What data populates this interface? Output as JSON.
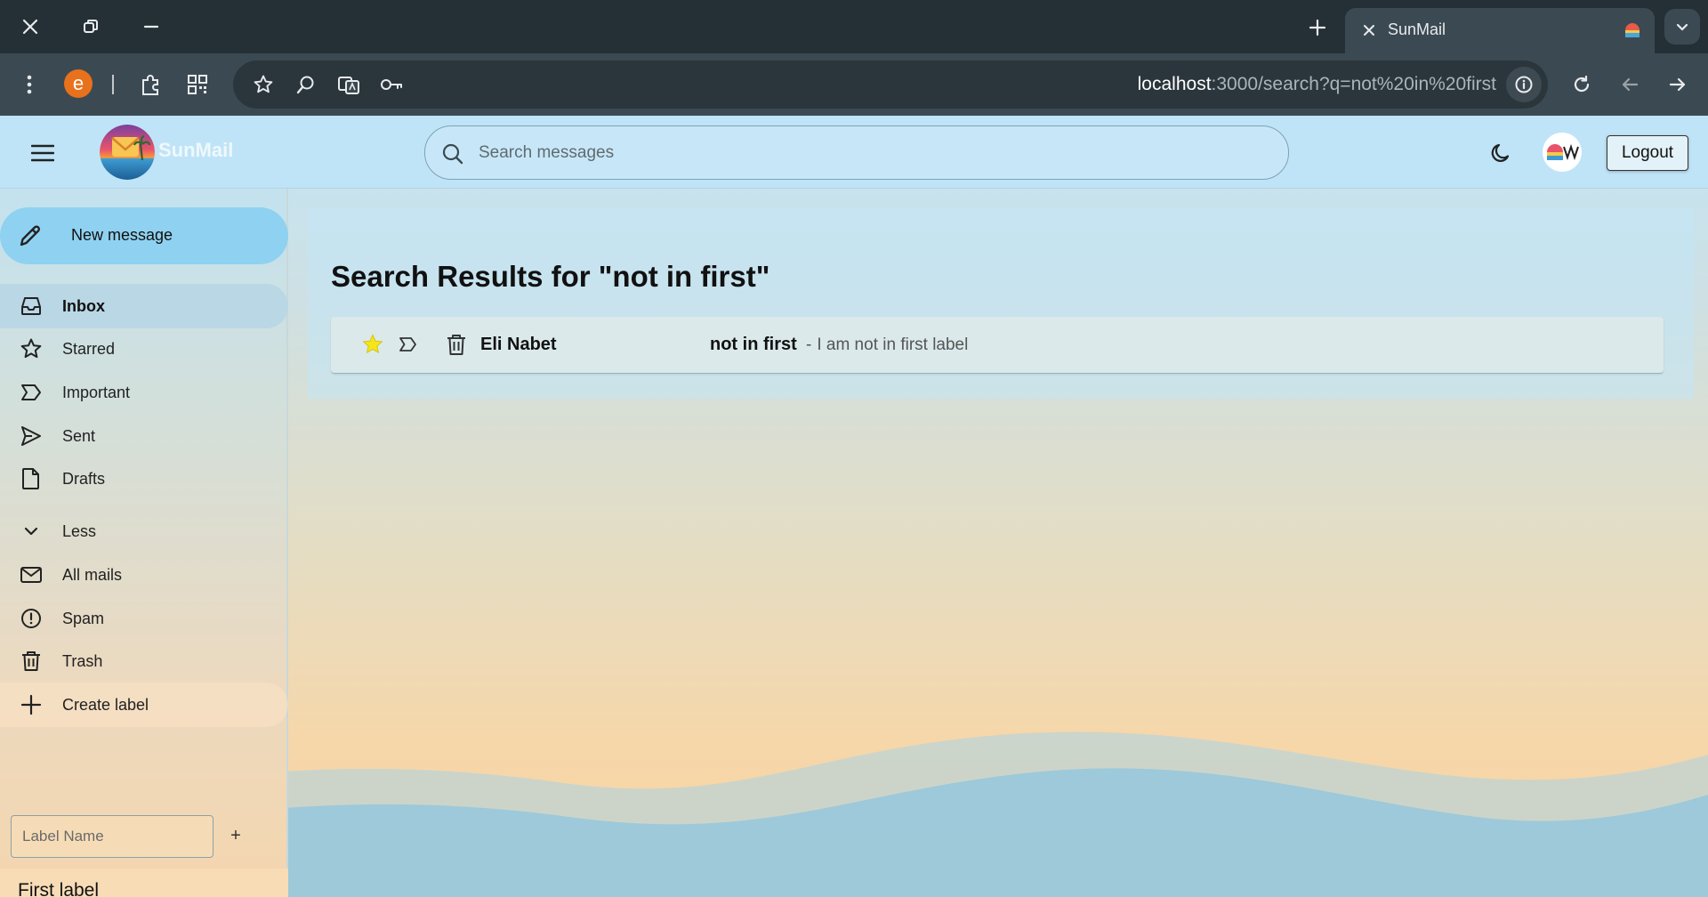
{
  "browser": {
    "tab_title": "SunMail",
    "url_host": "localhost",
    "url_path": ":3000/search?q=not%20in%20first",
    "extension_letter": "e"
  },
  "header": {
    "logo_text": "SunMail",
    "search_placeholder": "Search messages",
    "search_value": "",
    "logout_label": "Logout"
  },
  "sidebar": {
    "new_message_label": "New message",
    "items": [
      {
        "label": "Inbox",
        "icon": "inbox-icon",
        "active": true
      },
      {
        "label": "Starred",
        "icon": "star-icon"
      },
      {
        "label": "Important",
        "icon": "important-icon"
      },
      {
        "label": "Sent",
        "icon": "send-icon"
      },
      {
        "label": "Drafts",
        "icon": "draft-icon"
      },
      {
        "label": "Less",
        "icon": "chevron-down-icon"
      },
      {
        "label": "All mails",
        "icon": "mail-icon"
      },
      {
        "label": "Spam",
        "icon": "spam-icon"
      },
      {
        "label": "Trash",
        "icon": "trash-icon"
      },
      {
        "label": "Create label",
        "icon": "plus-icon"
      }
    ],
    "label_input_placeholder": "Label Name",
    "label_add_symbol": "+",
    "custom_labels": [
      "First label"
    ]
  },
  "results": {
    "heading": "Search Results for \"not in first\"",
    "emails": [
      {
        "sender": "Eli Nabet",
        "subject": "not in first",
        "snippet_prefix": "-",
        "snippet": "I am not in first label",
        "starred": true
      }
    ]
  },
  "colors": {
    "accent": "#8fd1f0",
    "star": "#f5e61a",
    "header_bg": "#bfe4f7"
  }
}
